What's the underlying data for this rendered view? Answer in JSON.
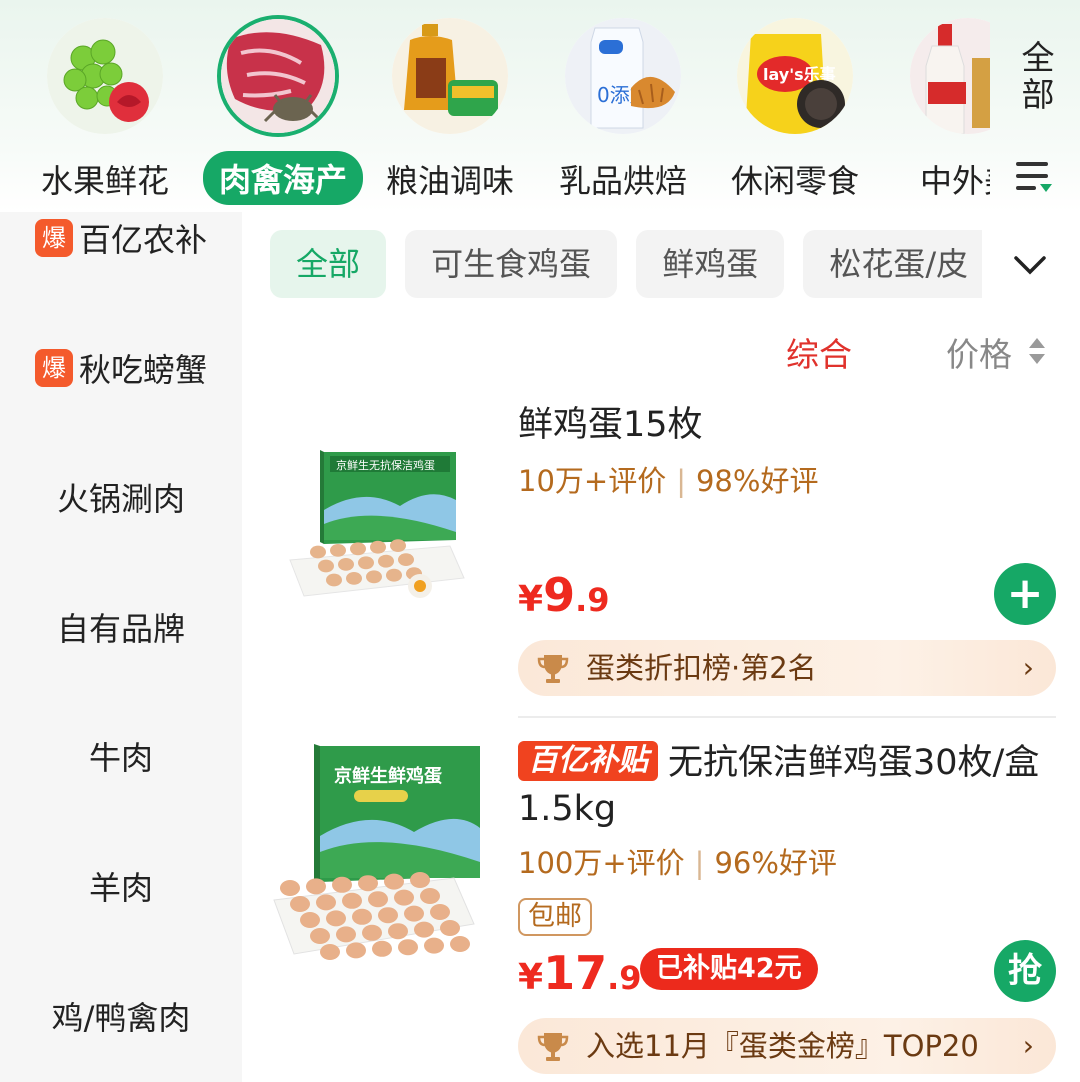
{
  "categories": [
    {
      "label": "水果鲜花",
      "icon": "fruit-flower-icon"
    },
    {
      "label": "肉禽海产",
      "icon": "meat-seafood-icon",
      "active": true
    },
    {
      "label": "粮油调味",
      "icon": "grain-oil-icon"
    },
    {
      "label": "乳品烘焙",
      "icon": "dairy-bakery-icon"
    },
    {
      "label": "休闲零食",
      "icon": "snacks-icon"
    },
    {
      "label": "中外美",
      "icon": "liquor-icon"
    }
  ],
  "all_categories_label": "全部",
  "sidebar": {
    "items": [
      {
        "label": "百亿农补",
        "badge": "爆"
      },
      {
        "label": "秋吃螃蟹",
        "badge": "爆"
      },
      {
        "label": "火锅涮肉"
      },
      {
        "label": "自有品牌"
      },
      {
        "label": "牛肉"
      },
      {
        "label": "羊肉"
      },
      {
        "label": "鸡/鸭禽肉"
      }
    ]
  },
  "filters": [
    "全部",
    "可生食鸡蛋",
    "鲜鸡蛋",
    "松花蛋/皮"
  ],
  "sort": {
    "comprehensive": "综合",
    "price": "价格"
  },
  "products": [
    {
      "title": "鲜鸡蛋15枚",
      "reviews": "10万+评价",
      "good_rate": "98%好评",
      "price_currency": "¥",
      "price_int": "9",
      "price_dec": ".9",
      "action": "+",
      "rank_text": "蛋类折扣榜·第2名",
      "box_text": "京鲜生无抗保洁鸡蛋",
      "eggs": 15
    },
    {
      "tag": "百亿补贴",
      "title": "无抗保洁鲜鸡蛋30枚/盒1.5kg",
      "reviews": "100万+评价",
      "good_rate": "96%好评",
      "shipping": "包邮",
      "price_currency": "¥",
      "price_int": "17",
      "price_dec": ".9",
      "subsidy": "已补贴42元",
      "action": "抢",
      "rank_text": "入选11月『蛋类金榜』TOP20",
      "box_text": "京鲜生鲜鸡蛋",
      "eggs": 30
    }
  ],
  "colors": {
    "brand_green": "#16a866",
    "price_red": "#ee2a1f",
    "rating_brown": "#b46a1e"
  }
}
